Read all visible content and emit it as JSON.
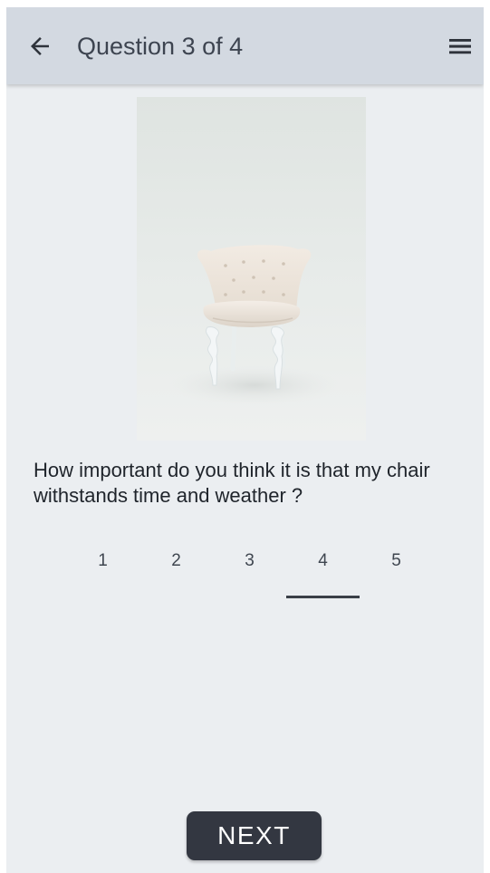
{
  "header": {
    "title": "Question 3 of 4",
    "back_icon": "arrow-left-icon",
    "menu_icon": "hamburger-menu-icon"
  },
  "image": {
    "subject": "armchair-photo"
  },
  "question": {
    "text": "How important do you think it is that my chair withstands time and weather ?"
  },
  "rating": {
    "options": [
      "1",
      "2",
      "3",
      "4",
      "5"
    ],
    "selected": "4"
  },
  "footer": {
    "next_label": "NEXT"
  },
  "colors": {
    "appbar": "#d3d9e1",
    "background": "#ebeef1",
    "button": "#333741",
    "text": "#1f242b"
  }
}
